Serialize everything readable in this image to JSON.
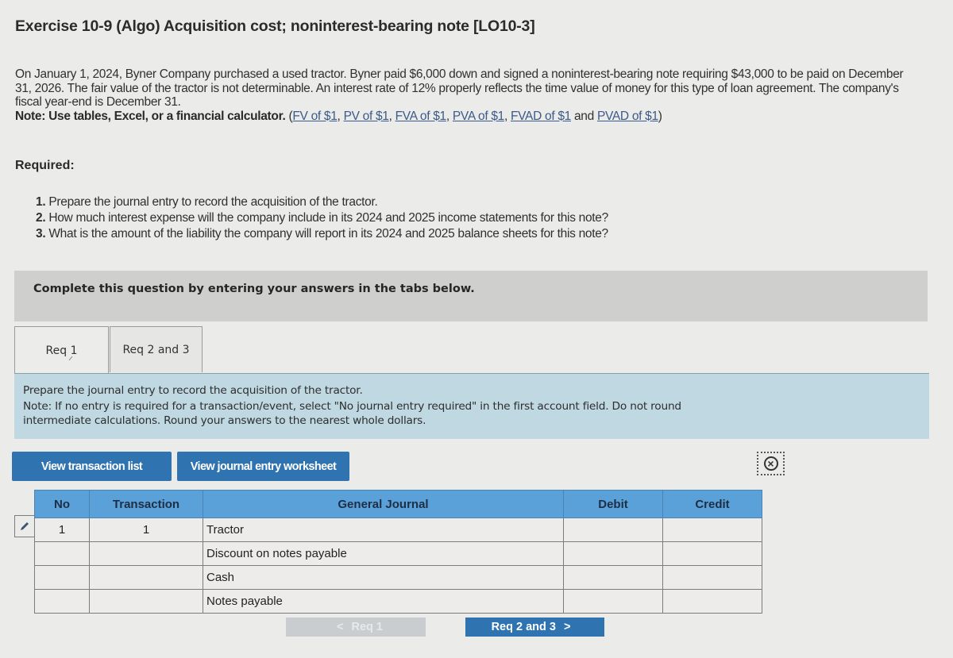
{
  "title": "Exercise 10-9 (Algo) Acquisition cost; noninterest-bearing note [LO10-3]",
  "intro": {
    "paragraph": "On January 1, 2024, Byner Company purchased a used tractor. Byner paid $6,000 down and signed a noninterest-bearing note requiring $43,000 to be paid on December 31, 2026. The fair value of the tractor is not determinable. An interest rate of 12% properly reflects the time value of money for this type of loan agreement. The company's fiscal year-end is December 31.",
    "note_label": "Note: Use tables, Excel, or a financial calculator.",
    "links": [
      "FV of $1",
      "PV of $1",
      "FVA of $1",
      "PVA of $1",
      "FVAD of $1",
      "PVAD of $1"
    ],
    "sep_comma": ", ",
    "sep_and": " and ",
    "open_paren": " (",
    "close_paren": ")"
  },
  "required": {
    "label": "Required:",
    "items": [
      {
        "num": "1.",
        "text": "Prepare the journal entry to record the acquisition of the tractor."
      },
      {
        "num": "2.",
        "text": "How much interest expense will the company include in its 2024 and 2025 income statements for this note?"
      },
      {
        "num": "3.",
        "text": "What is the amount of the liability the company will report in its 2024 and 2025 balance sheets for this note?"
      }
    ]
  },
  "banner": "Complete this question by entering your answers in the tabs below.",
  "tabs": [
    {
      "label": "Req 1",
      "active": true
    },
    {
      "label": "Req 2 and 3",
      "active": false
    }
  ],
  "instructions": {
    "line1": "Prepare the journal entry to record the acquisition of the tractor.",
    "line2": "Note: If no entry is required for a transaction/event, select \"No journal entry required\" in the first account field. Do not round",
    "line3": "intermediate calculations. Round your answers to the nearest whole dollars."
  },
  "buttons": {
    "view_transaction_list": "View transaction list",
    "view_journal_worksheet": "View journal entry worksheet",
    "clear_icon": "clear-icon"
  },
  "journal": {
    "headers": [
      "No",
      "Transaction",
      "General Journal",
      "Debit",
      "Credit"
    ],
    "rows": [
      {
        "no": "1",
        "transaction": "1",
        "account": "Tractor",
        "debit": "",
        "credit": ""
      },
      {
        "no": "",
        "transaction": "",
        "account": "Discount on notes payable",
        "debit": "",
        "credit": ""
      },
      {
        "no": "",
        "transaction": "",
        "account": "Cash",
        "debit": "",
        "credit": ""
      },
      {
        "no": "",
        "transaction": "",
        "account": "Notes payable",
        "debit": "",
        "credit": ""
      }
    ]
  },
  "nav": {
    "prev_label": "Req 1",
    "prev_arrow": "<",
    "next_label": "Req 2 and 3",
    "next_arrow": ">"
  },
  "colors": {
    "accent_blue": "#2f73b0",
    "table_header": "#5aa1d9",
    "instruction_bg": "#bfd8e1",
    "banner_bg": "#cfcfcd"
  }
}
